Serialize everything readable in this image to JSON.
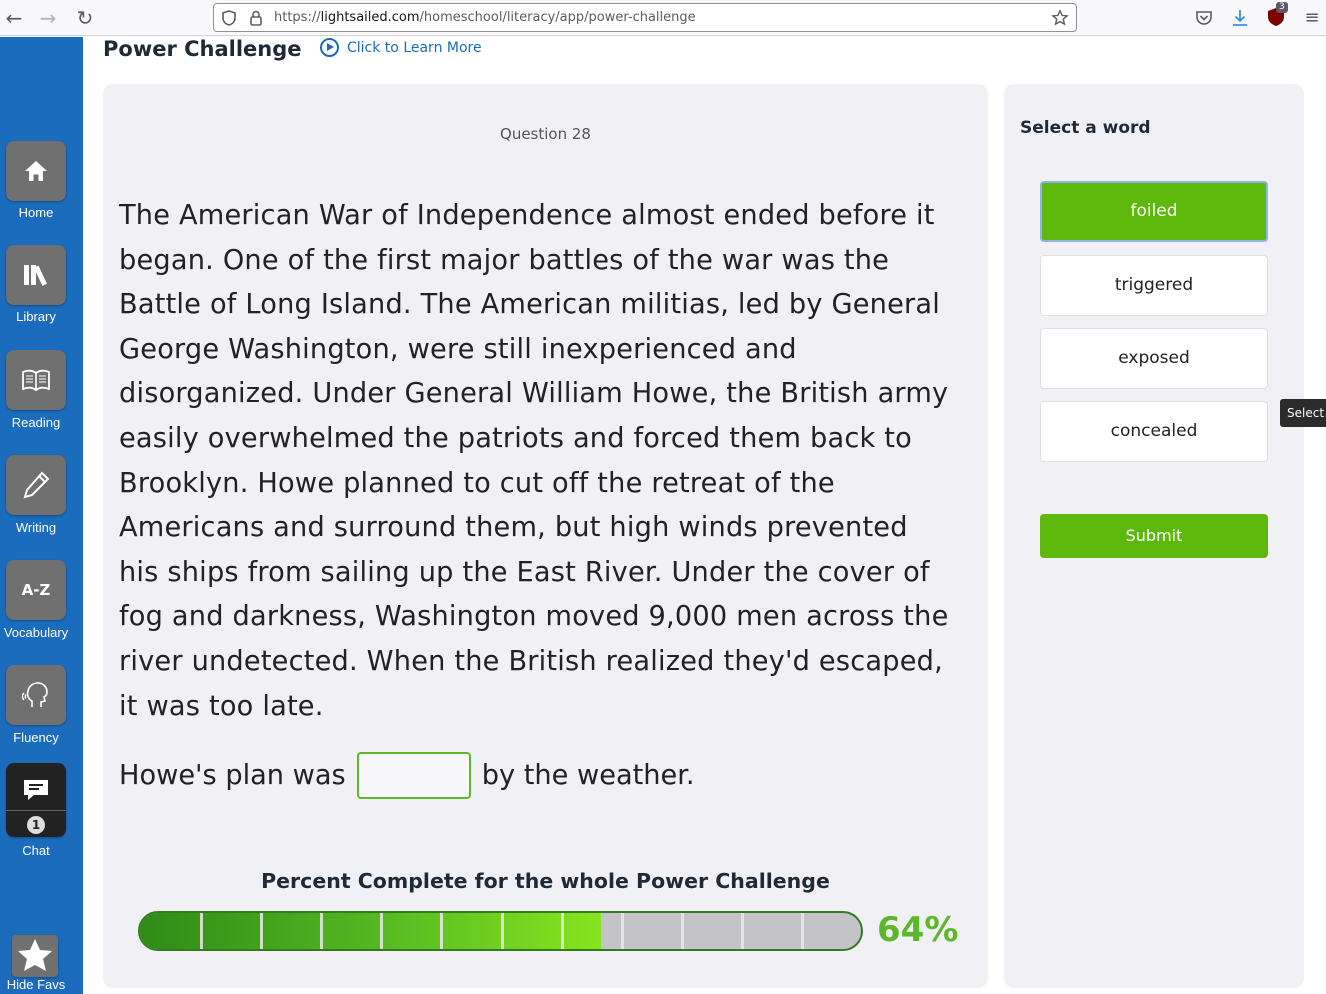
{
  "browser": {
    "url_prefix": "https://",
    "url_host": "lightsailed.com",
    "url_path": "/homeschool/literacy/app/power-challenge",
    "badge_count": "3"
  },
  "sidebar": {
    "items": [
      {
        "label": "Home",
        "icon": "home-icon"
      },
      {
        "label": "Library",
        "icon": "library-icon"
      },
      {
        "label": "Reading",
        "icon": "book-icon"
      },
      {
        "label": "Writing",
        "icon": "pencil-icon"
      },
      {
        "label": "Vocabulary",
        "icon": "a-z-icon",
        "icon_text": "A-Z"
      },
      {
        "label": "Fluency",
        "icon": "speaking-head-icon"
      },
      {
        "label": "Chat",
        "icon": "chat-icon",
        "badge": "1"
      }
    ],
    "hide_favs_label": "Hide Favs"
  },
  "header": {
    "title": "Power Challenge",
    "learn_more": "Click to Learn More"
  },
  "question": {
    "number_label": "Question 28",
    "passage": "The American War of Independence almost ended before it began. One of the first major battles of the war was the Battle of Long Island. The American militias, led by General George Washington, were still inexperienced and disorganized. Under General William Howe, the British army easily overwhelmed the patriots and forced them back to Brooklyn. Howe planned to cut off the retreat of the Americans and surround them, but high winds prevented his ships from sailing up the East River. Under the cover of fog and darkness, Washington moved 9,000 men across the river undetected. When the British realized they'd escaped, it was too late.",
    "sentence_before": "Howe's plan was",
    "sentence_after": "by the weather.",
    "blank_value": ""
  },
  "progress": {
    "title": "Percent Complete for the whole Power Challenge",
    "percent": 64,
    "percent_label": "64%",
    "segments": 12
  },
  "word_panel": {
    "title": "Select a word",
    "options": [
      "foiled",
      "triggered",
      "exposed",
      "concealed"
    ],
    "selected": "foiled",
    "submit_label": "Submit"
  },
  "tooltip": {
    "text": "Select a"
  },
  "colors": {
    "sidebar_blue": "#1b6cbd",
    "accent_green": "#5cb80a",
    "card_bg": "#f1f1f5"
  }
}
